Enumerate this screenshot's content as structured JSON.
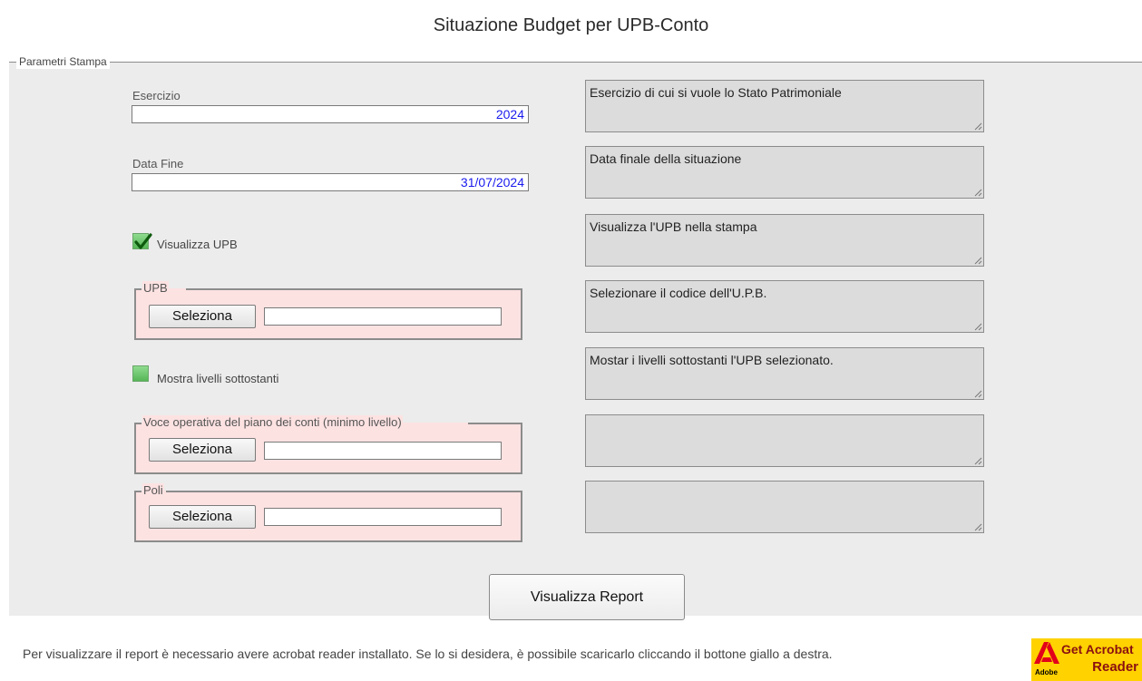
{
  "page": {
    "title": "Situazione Budget per UPB-Conto"
  },
  "params": {
    "legend": "Parametri Stampa",
    "esercizio": {
      "label": "Esercizio",
      "value": "2024",
      "help": "Esercizio di cui si vuole lo Stato Patrimoniale"
    },
    "data_fine": {
      "label": "Data Fine",
      "value": "31/07/2024",
      "help": "Data finale della situazione"
    },
    "visualizza_upb": {
      "label": "Visualizza UPB",
      "checked": true,
      "help": "Visualizza l'UPB nella stampa"
    },
    "upb": {
      "legend": "UPB",
      "button": "Seleziona",
      "value": "",
      "help": "Selezionare il codice dell'U.P.B."
    },
    "mostra_livelli": {
      "label": "Mostra livelli sottostanti",
      "checked": false,
      "help": "Mostar i livelli sottostanti l'UPB selezionato."
    },
    "voce_operativa": {
      "legend": "Voce operativa del piano dei conti (minimo livello)",
      "button": "Seleziona",
      "value": "",
      "help": ""
    },
    "poli": {
      "legend": "Poli",
      "button": "Seleziona",
      "value": "",
      "help": ""
    }
  },
  "actions": {
    "report_button": "Visualizza Report"
  },
  "footer": {
    "note": "Per visualizzare il report è necessario avere acrobat reader installato. Se lo si desidera, è possibile scaricarlo cliccando il bottone giallo a destra.",
    "acrobat": {
      "line1": "Get Acrobat",
      "line2": "Reader",
      "brand": "Adobe",
      "icon": "adobe-logo-icon"
    }
  },
  "colors": {
    "group_background": "#fde2e2",
    "panel_background": "#ececec",
    "value_text": "#1a1aee",
    "acrobat_yellow": "#ffd200"
  }
}
